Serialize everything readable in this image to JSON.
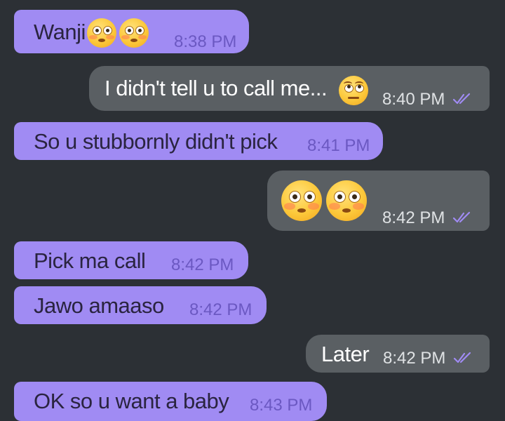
{
  "chat": {
    "messages": [
      {
        "direction": "incoming",
        "text": "Wanji",
        "emojis": [
          "flushed-face",
          "flushed-face"
        ],
        "time": "8:38 PM"
      },
      {
        "direction": "outgoing",
        "text": "I didn't tell u to call me...",
        "emojis": [
          "face-with-rolling-eyes"
        ],
        "time": "8:40 PM",
        "status": "read"
      },
      {
        "direction": "incoming",
        "text": "So u stubbornly didn't pick",
        "time": "8:41 PM"
      },
      {
        "direction": "outgoing",
        "text": "",
        "emojis": [
          "flushed-face",
          "flushed-face"
        ],
        "time": "8:42 PM",
        "status": "read"
      },
      {
        "direction": "incoming",
        "text": "Pick ma call",
        "time": "8:42 PM"
      },
      {
        "direction": "incoming",
        "text": "Jawo amaaso",
        "time": "8:42 PM"
      },
      {
        "direction": "outgoing",
        "text": "Later",
        "time": "8:42 PM",
        "status": "read"
      },
      {
        "direction": "incoming",
        "text": "OK so u want a baby",
        "time": "8:43 PM"
      }
    ]
  },
  "colors": {
    "background": "#2c3035",
    "incoming_bubble": "#a08bf3",
    "outgoing_bubble": "#5a5f63",
    "read_ticks": "#a08bf3"
  }
}
